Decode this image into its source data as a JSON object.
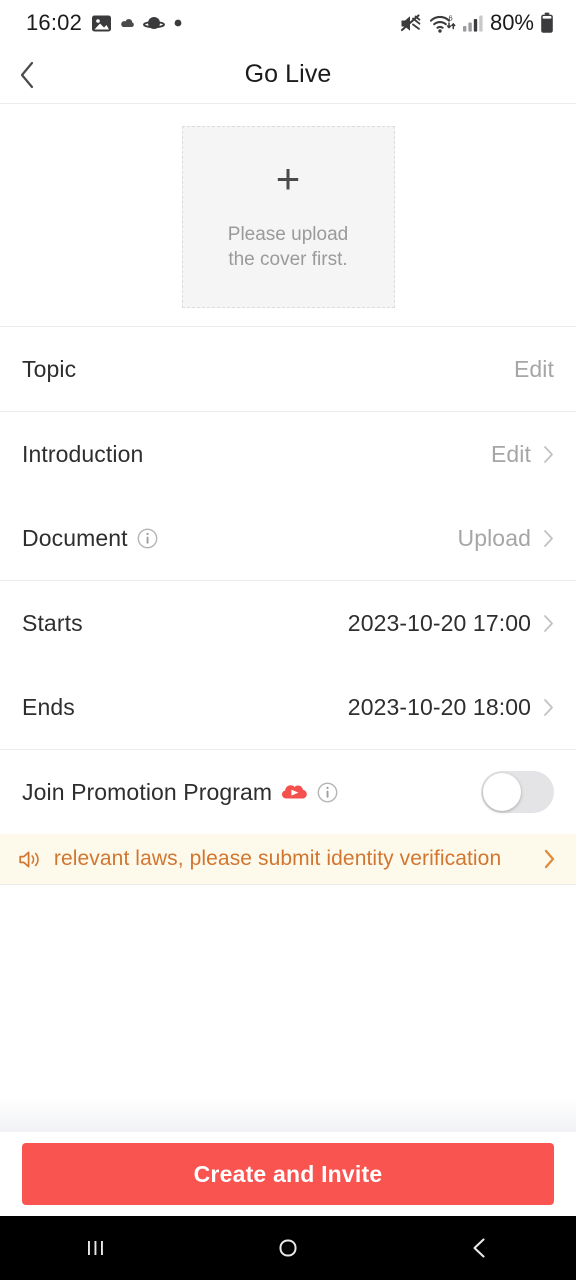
{
  "status_bar": {
    "clock": "16:02",
    "left_icons": [
      "gallery-icon",
      "cloud-icon",
      "saturn-icon",
      "dot-icon"
    ],
    "right_icons": [
      "volume-muted-icon",
      "wifi-6-icon",
      "cellular-signal-icon"
    ],
    "battery_text": "80%",
    "battery_icon": "battery-icon"
  },
  "header": {
    "back_icon": "chevron-left-icon",
    "title": "Go Live"
  },
  "cover": {
    "plus_icon": "plus-icon",
    "hint_line1": "Please upload",
    "hint_line2": "the cover first."
  },
  "rows": [
    {
      "label": "Topic",
      "value": "Edit",
      "value_style": "muted",
      "chevron": false,
      "info": false,
      "name": "topic"
    },
    {
      "label": "Introduction",
      "value": "Edit",
      "value_style": "muted",
      "chevron": true,
      "info": false,
      "name": "introduction"
    },
    {
      "label": "Document",
      "value": "Upload",
      "value_style": "muted",
      "chevron": true,
      "info": true,
      "name": "document"
    },
    {
      "label": "Starts",
      "value": "2023-10-20 17:00",
      "value_style": "dark",
      "chevron": true,
      "info": false,
      "name": "starts"
    },
    {
      "label": "Ends",
      "value": "2023-10-20 18:00",
      "value_style": "dark",
      "chevron": true,
      "info": false,
      "name": "ends"
    }
  ],
  "promotion": {
    "label": "Join Promotion Program",
    "promo_icon": "promotion-megaphone-icon",
    "info_icon": "info-circle-icon",
    "toggle_state": "off"
  },
  "notice": {
    "speaker_icon": "announcement-speaker-icon",
    "text": "According to relevant laws, please submit identity verification",
    "visible_text": "ording to relevant laws, please submit identity ver",
    "chevron_icon": "chevron-right-icon"
  },
  "cta": {
    "label": "Create and Invite"
  },
  "navbar": {
    "recents_icon": "recents-icon",
    "home_icon": "home-icon",
    "back_icon": "back-icon"
  },
  "colors": {
    "accent": "#f9544f",
    "notice_bg": "#fdfaec",
    "notice_text": "#d2762f",
    "muted_text": "#a6a6a6",
    "primary_text": "#2e2e2e",
    "divider": "#ececec",
    "cover_bg": "#f5f5f5",
    "toggle_track": "#e4e4e6"
  }
}
